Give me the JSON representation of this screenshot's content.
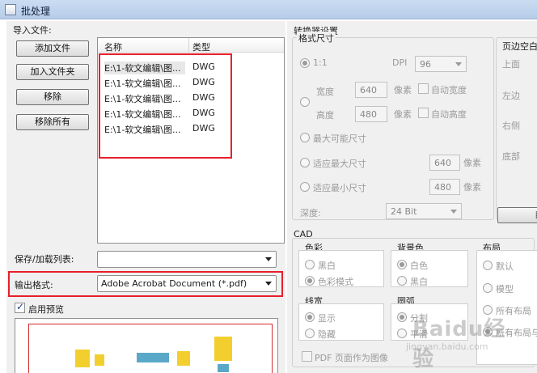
{
  "window": {
    "title": "批处理"
  },
  "import": {
    "group_label": "导入文件:",
    "buttons": {
      "add_file": "添加文件",
      "add_folder": "加入文件夹",
      "remove": "移除",
      "remove_all": "移除所有"
    },
    "columns": {
      "name": "名称",
      "type": "类型"
    },
    "files": [
      {
        "name": "E:\\1-软文编辑\\图...",
        "type": "DWG"
      },
      {
        "name": "E:\\1-软文编辑\\图...",
        "type": "DWG"
      },
      {
        "name": "E:\\1-软文编辑\\图...",
        "type": "DWG"
      },
      {
        "name": "E:\\1-软文编辑\\图...",
        "type": "DWG"
      },
      {
        "name": "E:\\1-软文编辑\\图...",
        "type": "DWG"
      }
    ]
  },
  "save_list": {
    "label": "保存/加载列表:",
    "value": ""
  },
  "output": {
    "label": "输出格式:",
    "value": "Adobe Acrobat Document (*.pdf)"
  },
  "preview": {
    "label": "启用预览",
    "checked": true
  },
  "converter": {
    "title": "转换器设置",
    "format_size": {
      "title": "格式尺寸",
      "ratio_label": "1:1",
      "dpi_label": "DPI",
      "dpi_value": "96",
      "width_label": "宽度",
      "width_value": "640",
      "height_label": "高度",
      "height_value": "480",
      "unit_px": "像素",
      "auto_width": "自动宽度",
      "auto_height": "自动高度",
      "max_possible": "最大可能尺寸",
      "fit_max": "适应最大尺寸",
      "fit_max_value": "640",
      "fit_min": "适应最小尺寸",
      "fit_min_value": "480",
      "depth_label": "深度:",
      "depth_value": "24 Bit"
    },
    "margins": {
      "title": "页边空白",
      "top": "上面",
      "left": "左边",
      "right": "右侧",
      "bottom": "底部",
      "button_partial": "自"
    },
    "cad": {
      "title": "CAD",
      "color": {
        "title": "色彩",
        "options": [
          "黑白",
          "色彩模式"
        ]
      },
      "background": {
        "title": "背景色",
        "options": [
          "白色",
          "黑白"
        ]
      },
      "layout": {
        "title": "布局",
        "options": [
          "默认",
          "模型",
          "所有布局",
          "所有布局与"
        ]
      },
      "lineweight": {
        "title": "线宽",
        "options": [
          "显示",
          "隐藏"
        ]
      },
      "arc": {
        "title": "圆弧",
        "options": [
          "分割",
          "平滑"
        ]
      },
      "pdf_as_image": "PDF 页面作为图像"
    }
  },
  "watermark": {
    "main": "Baidu经验",
    "sub": "jingyan.baidu.com"
  },
  "colors": {
    "highlight": "#e8202a",
    "titlebar": "#c9dcf2"
  }
}
